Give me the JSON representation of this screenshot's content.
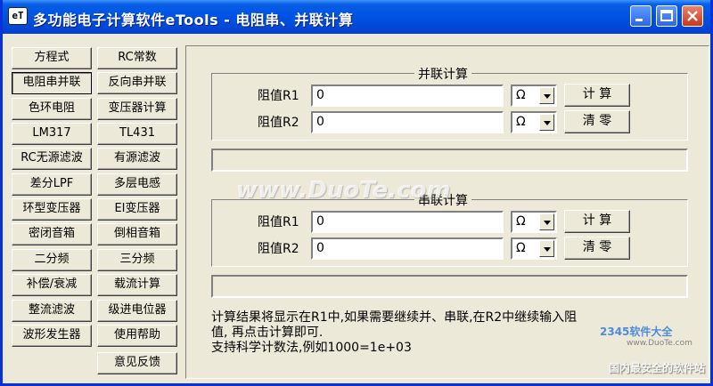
{
  "window": {
    "title": "多功能电子计算软件eTools - 电阻串、并联计算",
    "app_icon_text": "eT"
  },
  "sidebar": {
    "buttons": [
      "方程式",
      "RC常数",
      "电阻串并联",
      "反向串并联",
      "色环电阻",
      "变压器计算",
      "LM317",
      "TL431",
      "RC无源滤波",
      "有源滤波",
      "差分LPF",
      "多层电感",
      "环型变压器",
      "EI变压器",
      "密闭音箱",
      "倒相音箱",
      "二分频",
      "三分频",
      "补偿/衰减",
      "载流计算",
      "整流滤波",
      "级进电位器",
      "波形发生器",
      "使用帮助",
      "意见反馈"
    ]
  },
  "parallel": {
    "title": "并联计算",
    "r1_label": "阻值R1",
    "r1_value": "0",
    "r1_unit": "Ω",
    "r2_label": "阻值R2",
    "r2_value": "0",
    "r2_unit": "Ω",
    "calc_label": "计 算",
    "clear_label": "清 零"
  },
  "series": {
    "title": "串联计算",
    "r1_label": "阻值R1",
    "r1_value": "0",
    "r1_unit": "Ω",
    "r2_label": "阻值R2",
    "r2_value": "0",
    "r2_unit": "Ω",
    "calc_label": "计 算",
    "clear_label": "清 零"
  },
  "help": {
    "line1": "计算结果将显示在R1中,如果需要继续并、串联,在R2中继续输入阻",
    "line2": "值, 再点击计算即可.",
    "line3": "支持科学计数法,例如1000=1e+03"
  },
  "watermark": {
    "center": "www.DuoTe.com",
    "logo": "2345软件大全",
    "logo_url": "www.DuoTe.com",
    "slogan": "国内最安全的软件站"
  },
  "colors": {
    "titlebar": "#0055e5",
    "face": "#ece9d8",
    "border": "#0831d9"
  }
}
